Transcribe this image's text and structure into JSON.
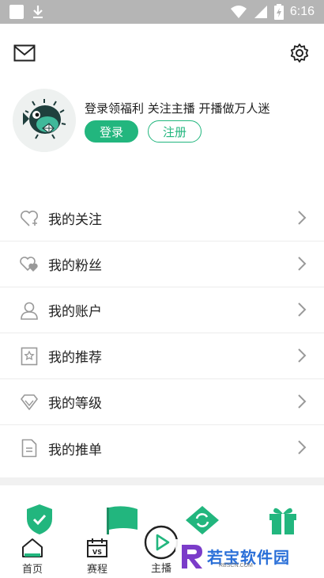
{
  "status_bar": {
    "time": "6:16",
    "icons": [
      "notification-square-icon",
      "download-icon",
      "wifi-icon",
      "signal-icon",
      "battery-charging-icon"
    ]
  },
  "top_bar": {
    "left_icon": "mail-icon",
    "right_icon": "settings-gear-icon"
  },
  "profile": {
    "avatar": "pufferfish-avatar",
    "promo_text": "登录领福利 关注主播 开播做万人迷",
    "login_label": "登录",
    "register_label": "注册"
  },
  "menu": {
    "items": [
      {
        "label": "我的关注",
        "icon": "heart-plus-icon"
      },
      {
        "label": "我的粉丝",
        "icon": "hearts-icon"
      },
      {
        "label": "我的账户",
        "icon": "user-icon"
      },
      {
        "label": "我的推荐",
        "icon": "bookmark-star-icon"
      },
      {
        "label": "我的等级",
        "icon": "diamond-icon"
      },
      {
        "label": "我的推单",
        "icon": "document-icon"
      }
    ]
  },
  "features": [
    "shield-icon",
    "flag-icon",
    "refresh-diamond-icon",
    "gift-icon"
  ],
  "bottom_nav": {
    "items": [
      {
        "label": "首页",
        "icon": "home-icon"
      },
      {
        "label": "赛程",
        "icon": "calendar-vs-icon"
      },
      {
        "label": "主播",
        "icon": "play-icon"
      }
    ]
  },
  "watermark": {
    "text": "若宝软件园",
    "sub": "RBSCN.COM"
  },
  "colors": {
    "accent": "#22b67e",
    "status_bar": "#b5b5b5",
    "divider": "#ececec"
  }
}
